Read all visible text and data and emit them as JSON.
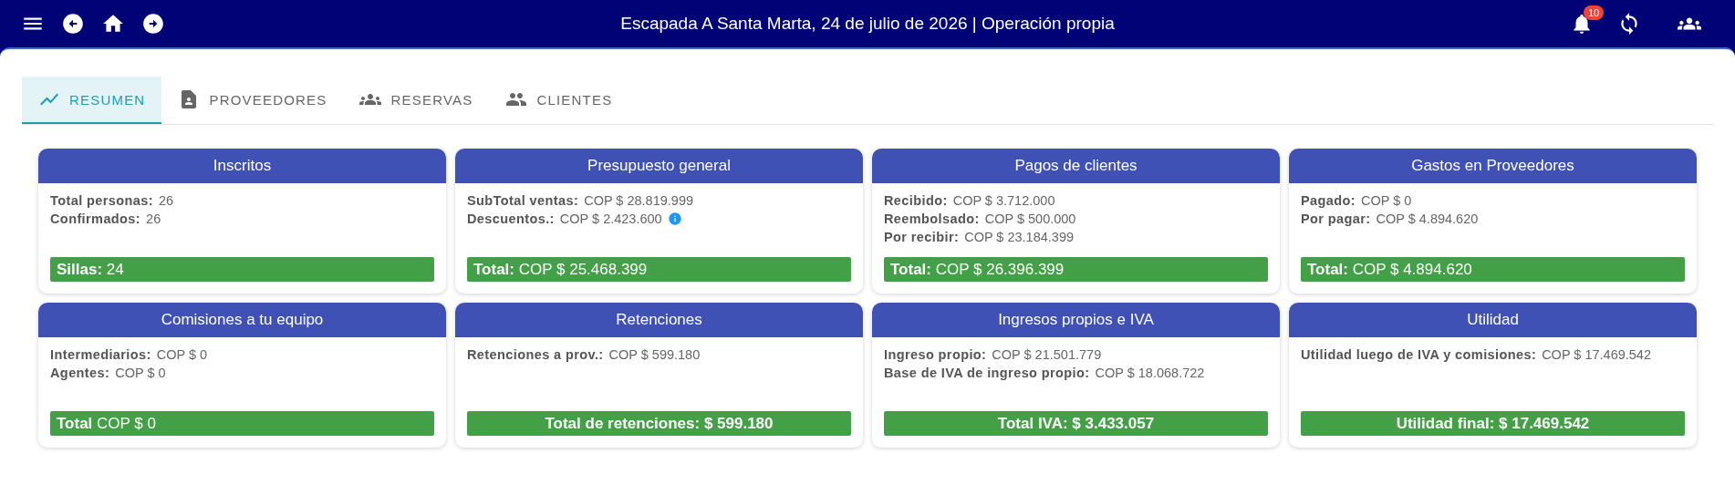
{
  "top_bar": {
    "title": "Escapada A Santa Marta, 24 de julio de 2026 | Operación propia",
    "notifications": "10"
  },
  "tabs": [
    {
      "label": "RESUMEN",
      "selected": true
    },
    {
      "label": "PROVEEDORES",
      "selected": false
    },
    {
      "label": "RESERVAS",
      "selected": false
    },
    {
      "label": "CLIENTES",
      "selected": false
    }
  ],
  "cards": [
    {
      "title": "Inscritos",
      "lines": [
        {
          "label": "Total personas:",
          "value": "26"
        },
        {
          "label": "Confirmados:",
          "value": "26"
        }
      ],
      "total": {
        "kind": "split",
        "text": "**Sillas:** 24"
      }
    },
    {
      "title": "Presupuesto general",
      "lines": [
        {
          "label": "SubTotal ventas:",
          "value": "COP $ 28.819.999"
        },
        {
          "label": "Descuentos.:",
          "value": "COP $ 2.423.600",
          "info": true
        }
      ],
      "total": {
        "kind": "split",
        "text": "**Total:** COP $ 25.468.399"
      }
    },
    {
      "title": "Pagos de clientes",
      "lines": [
        {
          "label": "Recibido:",
          "value": "COP $ 3.712.000"
        },
        {
          "label": "Reembolsado:",
          "value": "COP $ 500.000"
        },
        {
          "label": "Por recibir:",
          "value": "COP $ 23.184.399"
        }
      ],
      "total": {
        "kind": "split",
        "text": "**Total:** COP $ 26.396.399"
      }
    },
    {
      "title": "Gastos en Proveedores",
      "lines": [
        {
          "label": "Pagado:",
          "value": "COP $ 0"
        },
        {
          "label": "Por pagar:",
          "value": "COP $ 4.894.620"
        }
      ],
      "total": {
        "kind": "split",
        "text": "**Total:** COP $ 4.894.620"
      }
    },
    {
      "title": "Comisiones a tu equipo",
      "lines": [
        {
          "label": "Intermediarios:",
          "value": "COP $ 0"
        },
        {
          "label": "Agentes:",
          "value": "COP $ 0"
        }
      ],
      "total": {
        "kind": "split",
        "text": "**Total** COP $ 0"
      }
    },
    {
      "title": "Retenciones",
      "lines": [
        {
          "label": "Retenciones a prov.:",
          "value": "COP $ 599.180"
        }
      ],
      "total": {
        "kind": "centered",
        "text": "Total de retenciones: $ 599.180"
      }
    },
    {
      "title": "Ingresos propios e IVA",
      "lines": [
        {
          "label": "Ingreso propio:",
          "value": "COP $ 21.501.779"
        },
        {
          "label": "Base de IVA de ingreso propio:",
          "value": "COP $ 18.068.722"
        }
      ],
      "total": {
        "kind": "centered",
        "text": "Total IVA: $ 3.433.057"
      }
    },
    {
      "title": "Utilidad",
      "lines": [
        {
          "label": "Utilidad luego de IVA y comisiones:",
          "value": "COP $ 17.469.542"
        }
      ],
      "total": {
        "kind": "centered",
        "text": "Utilidad final: $ 17.469.542"
      }
    }
  ]
}
